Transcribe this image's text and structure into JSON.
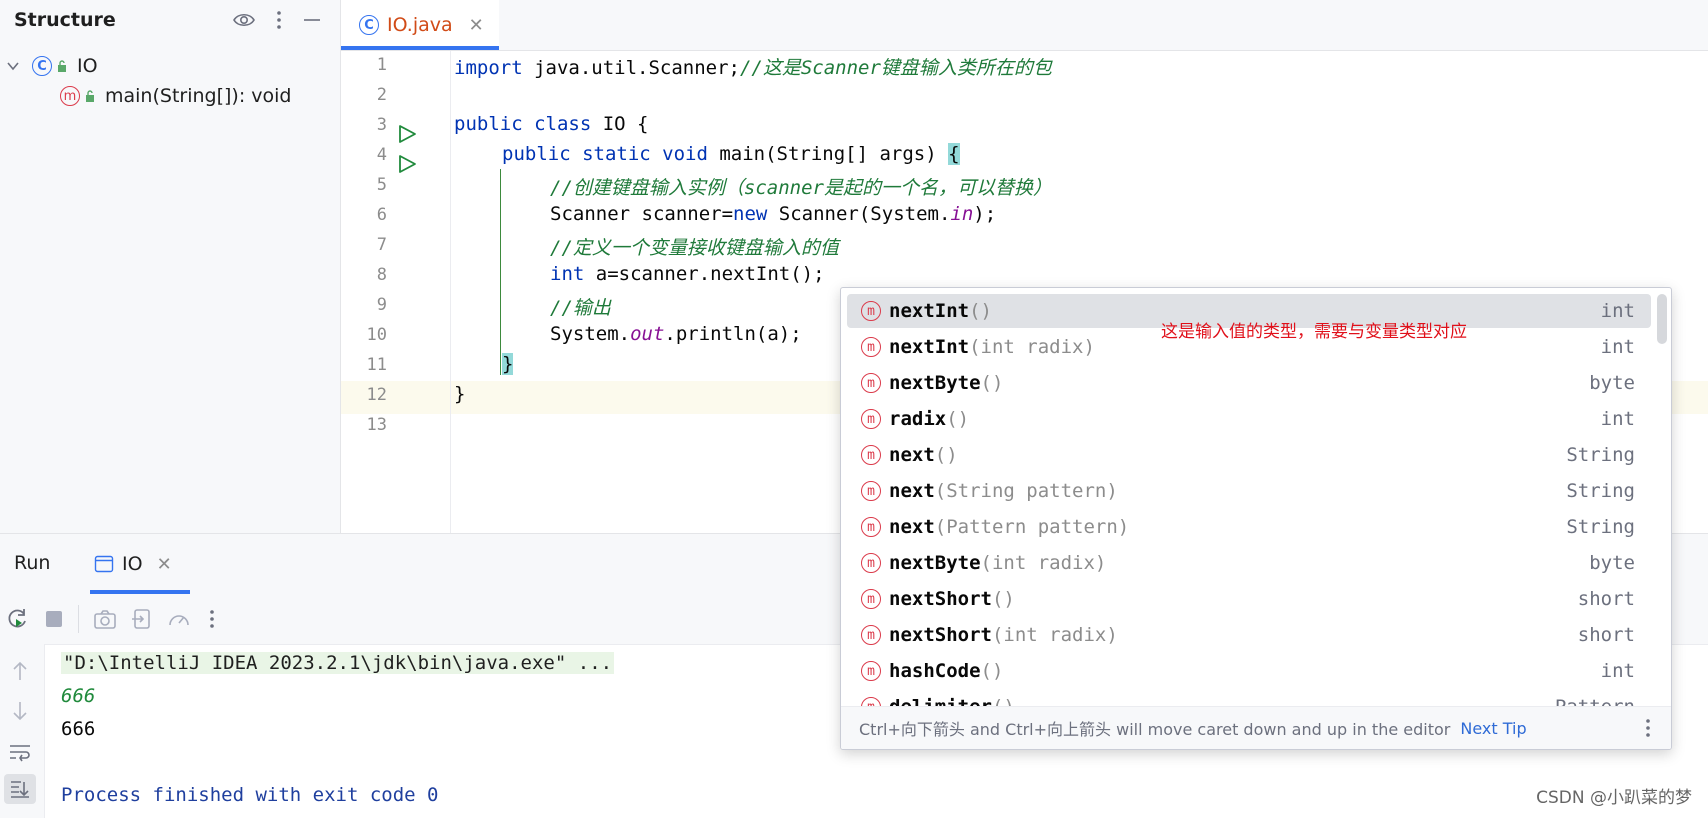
{
  "structure": {
    "title": "Structure",
    "tree": {
      "class_icon_letter": "C",
      "class_name": "IO",
      "method_icon_letter": "m",
      "method_name": "main(String[]): void"
    }
  },
  "editor": {
    "tab_label": "IO.java",
    "tab_icon_letter": "C",
    "line_numbers": [
      "1",
      "2",
      "3",
      "4",
      "5",
      "6",
      "7",
      "8",
      "9",
      "10",
      "11",
      "12",
      "13"
    ],
    "code": {
      "l1_import": "import",
      "l1_pkg": " java.util.Scanner;",
      "l1_comment": "//这是Scanner键盘输入类所在的包",
      "l3_kw": "public class",
      "l3_rest": " IO {",
      "l4_kw": "public static void",
      "l4_rest": " main(String[] args) ",
      "l4_brace": "{",
      "l5_comment": "//创建键盘输入实例（scanner是起的一个名，可以替换）",
      "l6_a": "Scanner scanner=",
      "l6_new": "new",
      "l6_b": " Scanner(System.",
      "l6_in": "in",
      "l6_c": ");",
      "l7_comment": "//定义一个变量接收键盘输入的值",
      "l8_int": "int",
      "l8_rest": " a=scanner.nextInt();",
      "l9_comment": "//输出",
      "l10_a": "System.",
      "l10_out": "out",
      "l10_b": ".println(a);",
      "l11_brace": "}",
      "l12_brace": "}"
    }
  },
  "completion": {
    "annotation": "这是输入值的类型，需要与变量类型对应",
    "items": [
      {
        "name": "nextInt",
        "params": "()",
        "ret": "int"
      },
      {
        "name": "nextInt",
        "params": "(int radix)",
        "ret": "int"
      },
      {
        "name": "nextByte",
        "params": "()",
        "ret": "byte"
      },
      {
        "name": "radix",
        "params": "()",
        "ret": "int"
      },
      {
        "name": "next",
        "params": "()",
        "ret": "String"
      },
      {
        "name": "next",
        "params": "(String pattern)",
        "ret": "String"
      },
      {
        "name": "next",
        "params": "(Pattern pattern)",
        "ret": "String"
      },
      {
        "name": "nextByte",
        "params": "(int radix)",
        "ret": "byte"
      },
      {
        "name": "nextShort",
        "params": "()",
        "ret": "short"
      },
      {
        "name": "nextShort",
        "params": "(int radix)",
        "ret": "short"
      },
      {
        "name": "hashCode",
        "params": "()",
        "ret": "int"
      },
      {
        "name": "delimiter",
        "params": "()",
        "ret": "Pattern"
      }
    ],
    "icon_letter": "m",
    "footer_text": "Ctrl+向下箭头 and Ctrl+向上箭头 will move caret down and up in the editor",
    "footer_link": "Next Tip"
  },
  "run": {
    "title": "Run",
    "tab_label": "IO",
    "console": {
      "cmd": "\"D:\\IntelliJ IDEA 2023.2.1\\jdk\\bin\\java.exe\" ...",
      "input": "666",
      "output": "666",
      "exit": "Process finished with exit code 0"
    }
  },
  "watermark": "CSDN @小趴菜的梦",
  "colors": {
    "accent": "#3574f0",
    "keyword": "#0033b3",
    "method_icon": "#db3b4b",
    "annotation": "#e0101a"
  },
  "icons": [
    "eye-icon",
    "more-vert-icon",
    "minimize-icon",
    "chevron-down-icon",
    "class-icon",
    "method-icon",
    "lock-icon",
    "close-icon",
    "run-gutter-icon",
    "rerun-icon",
    "stop-icon",
    "camera-icon",
    "export-icon",
    "speed-icon",
    "up-arrow-icon",
    "down-arrow-icon",
    "soft-wrap-icon",
    "scroll-end-icon",
    "console-tab-icon"
  ]
}
